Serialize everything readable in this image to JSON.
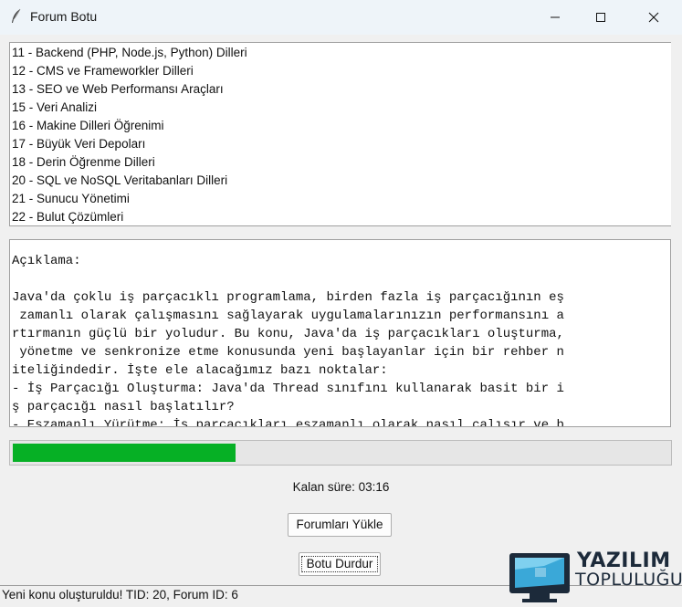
{
  "window": {
    "title": "Forum Botu"
  },
  "forum_list": {
    "items": [
      "11 - Backend (PHP, Node.js, Python) Dilleri",
      "12 - CMS ve Frameworkler Dilleri",
      "13 - SEO ve Web Performansı Araçları",
      "15 - Veri Analizi",
      "16 - Makine Dilleri  Öğrenimi",
      "17 - Büyük Veri Depoları",
      "18 - Derin Öğrenme Dilleri",
      "20 - SQL ve NoSQL Veritabanları Dilleri",
      "21 - Sunucu Yönetimi",
      "22 - Bulut Çözümleri"
    ]
  },
  "description": {
    "lines": [
      "Açıklama:",
      "",
      "Java'da çoklu iş parçacıklı programlama, birden fazla iş parçacığının eş",
      " zamanlı olarak çalışmasını sağlayarak uygulamalarınızın performansını a",
      "rtırmanın güçlü bir yoludur. Bu konu, Java'da iş parçacıkları oluşturma,",
      " yönetme ve senkronize etme konusunda yeni başlayanlar için bir rehber n",
      "iteliğindedir. İşte ele alacağımız bazı noktalar:",
      "- İş Parçacığı Oluşturma: Java'da Thread sınıfını kullanarak basit bir i",
      "ş parçacığı nasıl başlatılır?",
      "- Eşzamanlı Yürütme: İş parçacıkları eşzamanlı olarak nasıl çalışır ve b"
    ]
  },
  "progress": {
    "fraction": 0.34,
    "color": "#06b025"
  },
  "remaining_time": "Kalan süre: 03:16",
  "buttons": {
    "load_forums": "Forumları Yükle",
    "stop_bot": "Botu Durdur"
  },
  "status": "Yeni konu oluşturuldu! TID: 20, Forum ID: 6",
  "watermark": {
    "line1": "YAZILIM",
    "line2": "TOPLULUĞU"
  }
}
